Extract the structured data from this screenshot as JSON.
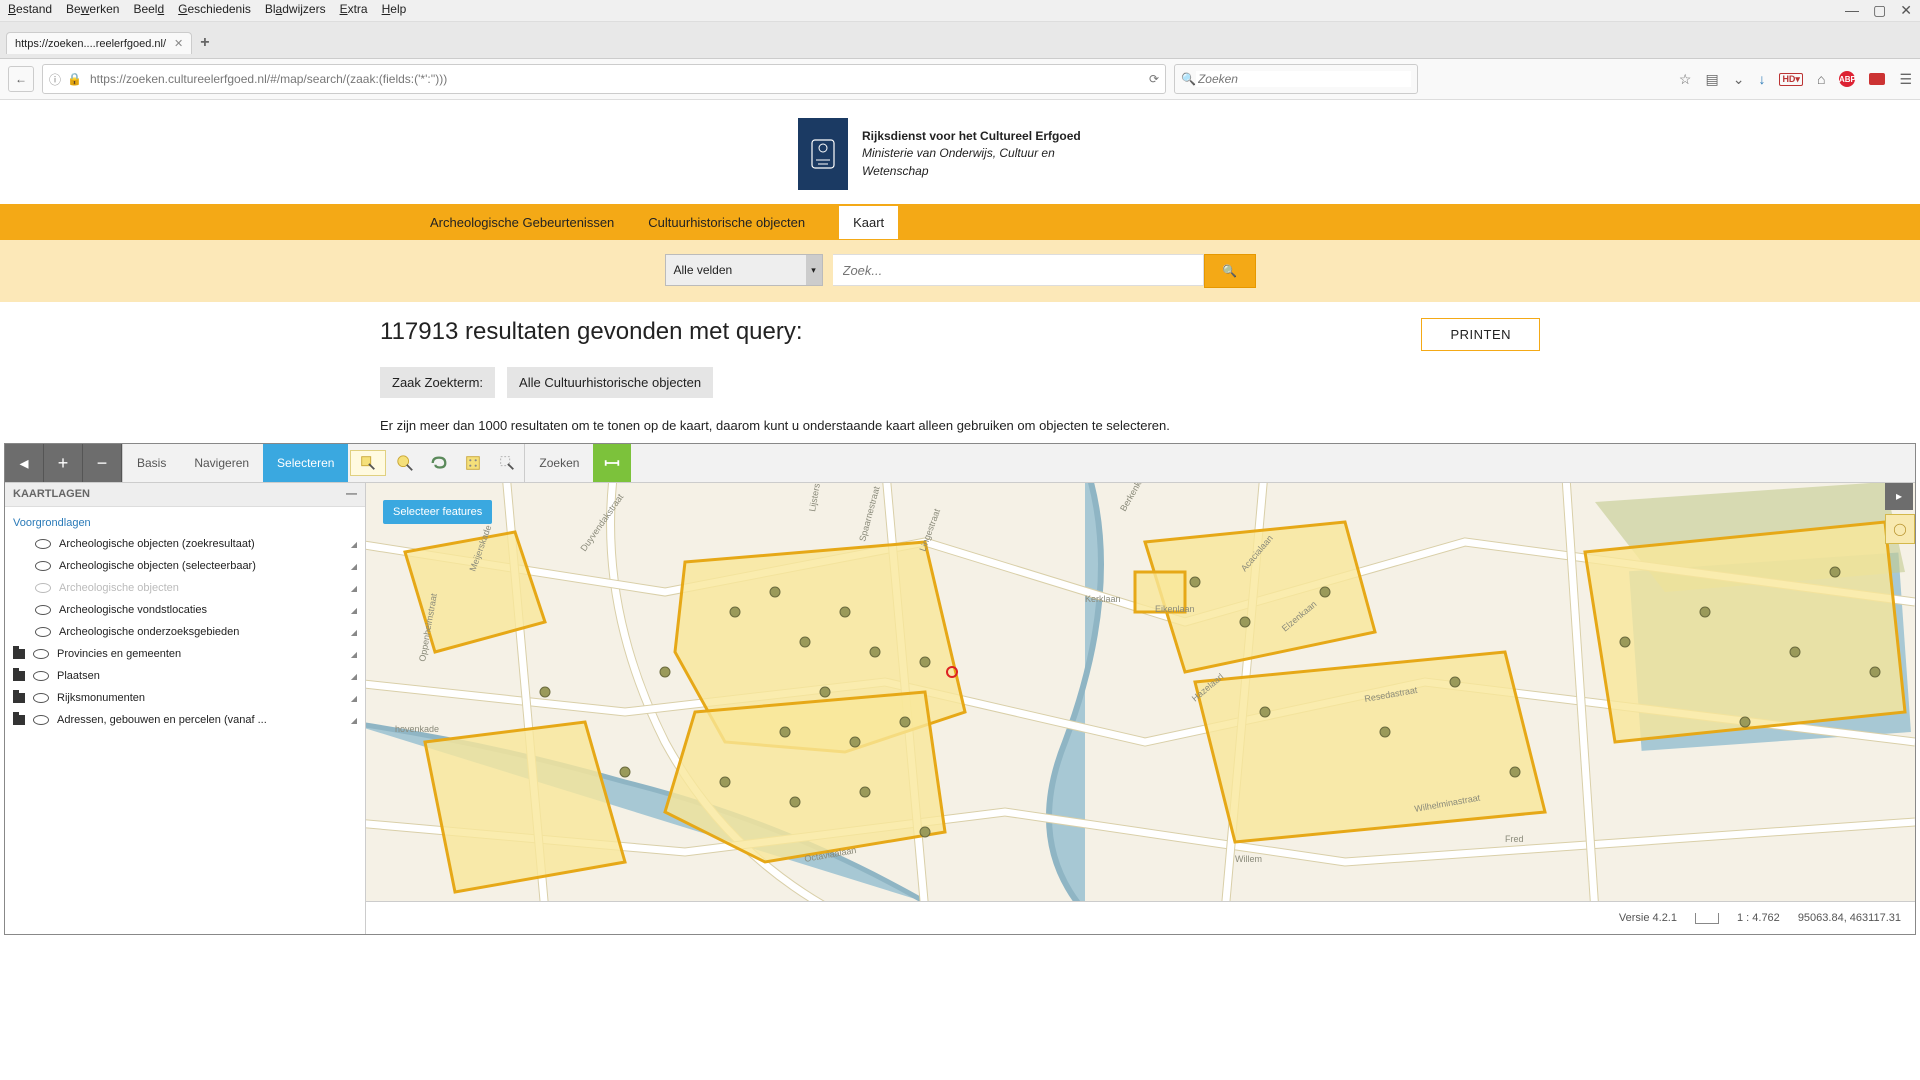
{
  "browser": {
    "menu": [
      "Bestand",
      "Bewerken",
      "Beeld",
      "Geschiedenis",
      "Bladwijzers",
      "Extra",
      "Help"
    ],
    "tab_title": "https://zoeken....reelerfgoed.nl/",
    "url_display": "https://zoeken.cultureelerfgoed.nl/#/map/search/(zaak:(fields:('*':'')))",
    "search_placeholder": "Zoeken"
  },
  "brand": {
    "name": "Rijksdienst voor het Cultureel Erfgoed",
    "ministry": "Ministerie van Onderwijs, Cultuur en Wetenschap"
  },
  "nav": {
    "items": [
      "Archeologische Gebeurtenissen",
      "Cultuurhistorische objecten",
      "Kaart"
    ],
    "active_index": 2
  },
  "searchbar": {
    "field_selector": "Alle velden",
    "placeholder": "Zoek..."
  },
  "results": {
    "count": "117913",
    "heading_suffix": " resultaten gevonden met query:",
    "print_label": "PRINTEN",
    "chips": [
      "Zaak Zoekterm:",
      "Alle Cultuurhistorische objecten"
    ],
    "limit_note": "Er zijn meer dan 1000 resultaten om te tonen op de kaart, daarom kunt u onderstaande kaart alleen gebruiken om objecten te selecteren."
  },
  "map_toolbar": {
    "modes": [
      "Basis",
      "Navigeren",
      "Selecteren",
      "Zoeken"
    ],
    "active_mode_index": 2,
    "tooltip": "Selecteer features"
  },
  "sidebar": {
    "title": "KAARTLAGEN",
    "section": "Voorgrondlagen",
    "layers": [
      {
        "label": "Archeologische objecten (zoekresultaat)",
        "type": "eye",
        "enabled": true,
        "indent": 1
      },
      {
        "label": "Archeologische objecten (selecteerbaar)",
        "type": "eye",
        "enabled": true,
        "indent": 1
      },
      {
        "label": "Archeologische objecten",
        "type": "eye",
        "enabled": false,
        "indent": 1
      },
      {
        "label": "Archeologische vondstlocaties",
        "type": "eye",
        "enabled": true,
        "indent": 1
      },
      {
        "label": "Archeologische onderzoeksgebieden",
        "type": "eye",
        "enabled": true,
        "indent": 1
      },
      {
        "label": "Provincies en gemeenten",
        "type": "folder",
        "enabled": true,
        "indent": 0
      },
      {
        "label": "Plaatsen",
        "type": "folder",
        "enabled": true,
        "indent": 0
      },
      {
        "label": "Rijksmonumenten",
        "type": "folder",
        "enabled": true,
        "indent": 0
      },
      {
        "label": "Adressen, gebouwen en percelen (vanaf ...",
        "type": "folder",
        "enabled": true,
        "indent": 0
      }
    ]
  },
  "statusbar": {
    "version": "Versie 4.2.1",
    "scale": "1 : 4.762",
    "coords": "95063.84, 463117.31"
  },
  "map_labels": {
    "streets": [
      "Meijerskade",
      "Oppenheimstraat",
      "Duyvendakstraat",
      "hovenkade",
      "Lijsterstraat",
      "Spaarnestraat",
      "Lingestraat",
      "Berkenkade",
      "Kerklaan",
      "Eikenlaan",
      "Hazelaarl",
      "Acacialaan",
      "Elzenkaan",
      "Resedastraat",
      "Wilhelminastraat",
      "Fred",
      "Octaviaalaan",
      "Willem"
    ]
  }
}
